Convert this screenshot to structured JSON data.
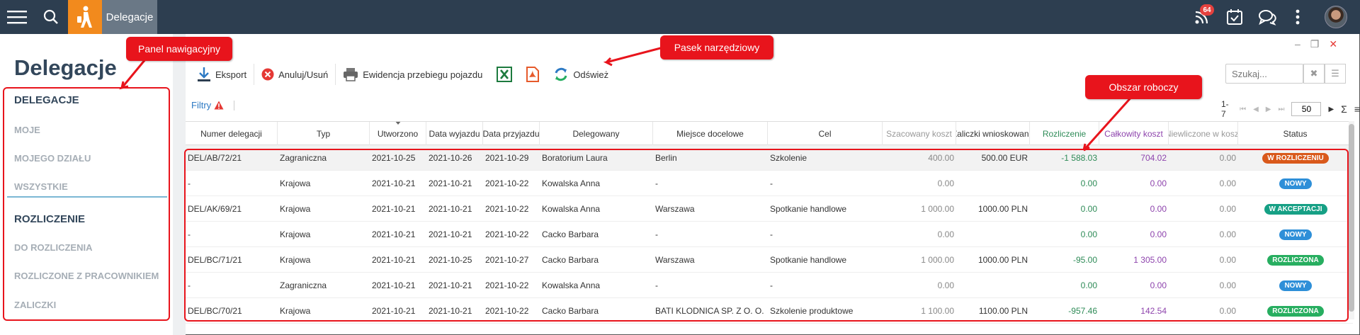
{
  "topbar": {
    "app_title": "Delegacje",
    "notification_count": "64"
  },
  "nav": {
    "title": "Delegacje",
    "items": [
      {
        "label": "DELEGACJE",
        "type": "header"
      },
      {
        "label": "MOJE",
        "type": "sub"
      },
      {
        "label": "MOJEGO DZIAŁU",
        "type": "sub"
      },
      {
        "label": "WSZYSTKIE",
        "type": "sub"
      },
      {
        "label": "ROZLICZENIE",
        "type": "header"
      },
      {
        "label": "DO ROZLICZENIA",
        "type": "sub"
      },
      {
        "label": "ROZLICZONE Z PRACOWNIKIEM",
        "type": "sub"
      },
      {
        "label": "ZALICZKI",
        "type": "sub"
      }
    ]
  },
  "toolbar": {
    "export_label": "Eksport",
    "cancel_label": "Anuluj/Usuń",
    "mileage_label": "Ewidencja przebiegu pojazdu",
    "refresh_label": "Odśwież",
    "search_placeholder": "Szukaj..."
  },
  "filters": {
    "label": "Filtry"
  },
  "pager": {
    "range": "1-7",
    "page_size": "50"
  },
  "table": {
    "columns": [
      "Numer delegacji",
      "Typ",
      "Utworzono",
      "Data wyjazdu",
      "Data przyjazdu",
      "Delegowany",
      "Miejsce docelowe",
      "Cel",
      "Szacowany koszt",
      "Zaliczki wnioskowane",
      "Rozliczenie",
      "Całkowity koszt",
      "Niewliczone w koszt",
      "Status"
    ],
    "rows": [
      [
        "DEL/AB/72/21",
        "Zagraniczna",
        "2021-10-25",
        "2021-10-26",
        "2021-10-29",
        "Boratorium Laura",
        "Berlin",
        "Szkolenie",
        "400.00",
        "500.00 EUR",
        "-1 588.03",
        "704.02",
        "0.00",
        "W ROZLICZENIU"
      ],
      [
        "-",
        "Krajowa",
        "2021-10-21",
        "2021-10-21",
        "2021-10-22",
        "Kowalska Anna",
        "-",
        "-",
        "0.00",
        "",
        "0.00",
        "0.00",
        "0.00",
        "NOWY"
      ],
      [
        "DEL/AK/69/21",
        "Krajowa",
        "2021-10-21",
        "2021-10-21",
        "2021-10-22",
        "Kowalska Anna",
        "Warszawa",
        "Spotkanie handlowe",
        "1 000.00",
        "1000.00 PLN",
        "0.00",
        "0.00",
        "0.00",
        "W AKCEPTACJI"
      ],
      [
        "-",
        "Krajowa",
        "2021-10-21",
        "2021-10-21",
        "2021-10-22",
        "Cacko Barbara",
        "-",
        "-",
        "0.00",
        "",
        "0.00",
        "0.00",
        "0.00",
        "NOWY"
      ],
      [
        "DEL/BC/71/21",
        "Krajowa",
        "2021-10-21",
        "2021-10-25",
        "2021-10-27",
        "Cacko Barbara",
        "Warszawa",
        "Spotkanie handlowe",
        "1 000.00",
        "1000.00 PLN",
        "-95.00",
        "1 305.00",
        "0.00",
        "ROZLICZONA"
      ],
      [
        "-",
        "Zagraniczna",
        "2021-10-21",
        "2021-10-21",
        "2021-10-22",
        "Kowalska Anna",
        "-",
        "-",
        "0.00",
        "",
        "0.00",
        "0.00",
        "0.00",
        "NOWY"
      ],
      [
        "DEL/BC/70/21",
        "Krajowa",
        "2021-10-21",
        "2021-10-21",
        "2021-10-22",
        "Cacko Barbara",
        "BATI KLODNICA SP. Z O. O.",
        "Szkolenie produktowe",
        "1 100.00",
        "1100.00 PLN",
        "-957.46",
        "142.54",
        "0.00",
        "ROZLICZONA"
      ]
    ],
    "status_colors": {
      "W ROZLICZENIU": "#d9591b",
      "NOWY": "#2e8fd8",
      "W AKCEPTACJI": "#16a085",
      "ROZLICZONA": "#27ae60"
    }
  },
  "annotations": {
    "nav_panel": "Panel nawigacyjny",
    "toolbar": "Pasek narzędziowy",
    "workspace": "Obszar roboczy"
  }
}
